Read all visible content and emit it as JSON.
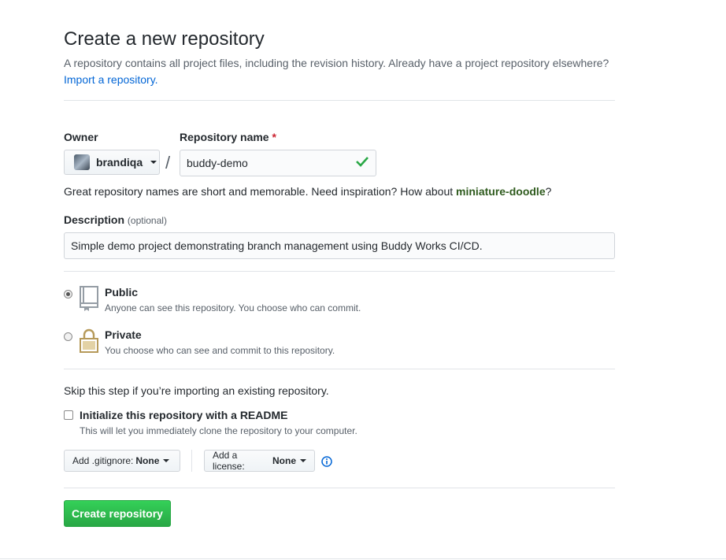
{
  "header": {
    "title": "Create a new repository",
    "subtitle": "A repository contains all project files, including the revision history. Already have a project repository elsewhere?",
    "import_link": "Import a repository."
  },
  "owner": {
    "label": "Owner",
    "value": "brandiqa"
  },
  "repo": {
    "label": "Repository name",
    "required_mark": "*",
    "value": "buddy-demo",
    "separator": "/"
  },
  "hint": {
    "text": "Great repository names are short and memorable. Need inspiration? How about",
    "suggestion": "miniature-doodle",
    "suffix": "?"
  },
  "description": {
    "label": "Description",
    "optional": "(optional)",
    "value": "Simple demo project demonstrating branch management using Buddy Works CI/CD."
  },
  "visibility": {
    "public_title": "Public",
    "public_note": "Anyone can see this repository. You choose who can commit.",
    "private_title": "Private",
    "private_note": "You choose who can see and commit to this repository.",
    "selected": "public"
  },
  "init": {
    "skip_note": "Skip this step if you’re importing an existing repository.",
    "readme_label": "Initialize this repository with a README",
    "readme_note": "This will let you immediately clone the repository to your computer.",
    "readme_checked": false
  },
  "selects": {
    "gitignore_prefix": "Add .gitignore:",
    "gitignore_value": "None",
    "license_prefix": "Add a license:",
    "license_value": "None"
  },
  "actions": {
    "create_label": "Create repository"
  },
  "colors": {
    "accent_link": "#0366d6",
    "success": "#28a745",
    "lock_gold": "#b69a5a"
  }
}
